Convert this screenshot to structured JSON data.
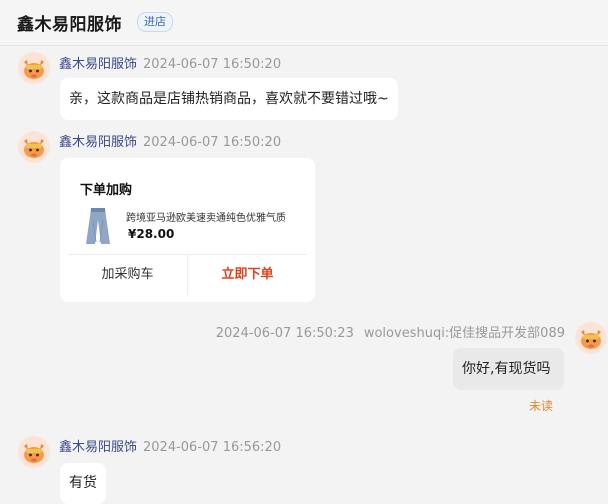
{
  "header": {
    "shop_name": "鑫木易阳服饰",
    "enter_label": "进店"
  },
  "messages": [
    {
      "sender": "鑫木易阳服饰",
      "time": "2024-06-07 16:50:20",
      "text": "亲，这款商品是店铺热销商品，喜欢就不要错过哦~"
    },
    {
      "sender": "鑫木易阳服饰",
      "time": "2024-06-07 16:50:20",
      "card": {
        "title": "下单加购",
        "product_name": "跨境亚马逊欧美速卖通纯色优雅气质",
        "price": "¥28.00",
        "cart_label": "加采购车",
        "buy_label": "立即下单"
      }
    },
    {
      "sender": "woloveshuqi:促佳搜品开发部089",
      "time": "2024-06-07 16:50:23",
      "text": "你好,有现货吗",
      "status": "未读"
    },
    {
      "sender": "鑫木易阳服饰",
      "time": "2024-06-07 16:56:20",
      "text": "有货"
    }
  ],
  "colors": {
    "sender_name": "#3a4a8a",
    "timestamp": "#999999",
    "buy_button": "#e0431a",
    "unread_status": "#d98a2b"
  }
}
